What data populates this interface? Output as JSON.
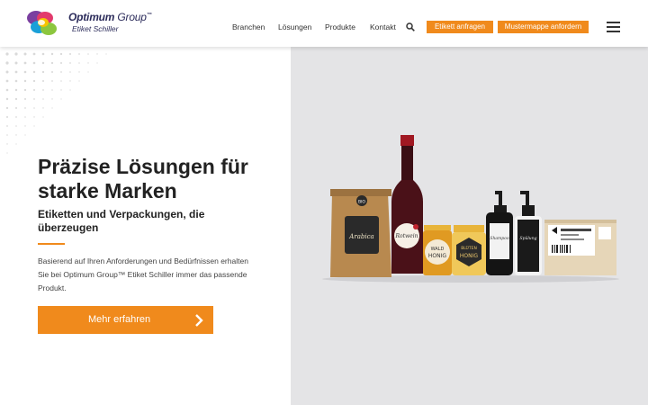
{
  "header": {
    "logo_title_bold": "Optimum",
    "logo_title_thin": " Group",
    "logo_tm": "™",
    "logo_sub": "Etiket Schiller",
    "nav": [
      {
        "label": "Branchen"
      },
      {
        "label": "Lösungen"
      },
      {
        "label": "Produkte"
      },
      {
        "label": "Kontakt"
      }
    ],
    "btn_label_request": "Etikett anfragen",
    "btn_label_samples": "Mustermappe anfordern"
  },
  "hero": {
    "title": "Präzise Lösungen für starke Marken",
    "subtitle": "Etiketten und Verpackungen, die überzeugen",
    "body": "Basierend auf Ihren Anforderungen und Bedürfnissen erhalten Sie bei Optimum Group™ Etiket Schiller immer das passende Produkt.",
    "cta_label": "Mehr erfahren"
  },
  "product_labels": {
    "bag_badge": "BIO",
    "bag_label": "Arabica",
    "wine_label": "Rotwein",
    "jar1_label": "WALD HONIG",
    "jar2_label": "BLÜTEN HONIG",
    "shampoo_label": "Shampoo",
    "soap_label": "Spülung"
  },
  "colors": {
    "accent": "#f08a1c",
    "hero_bg": "#e4e4e6",
    "text_dark": "#222222"
  }
}
